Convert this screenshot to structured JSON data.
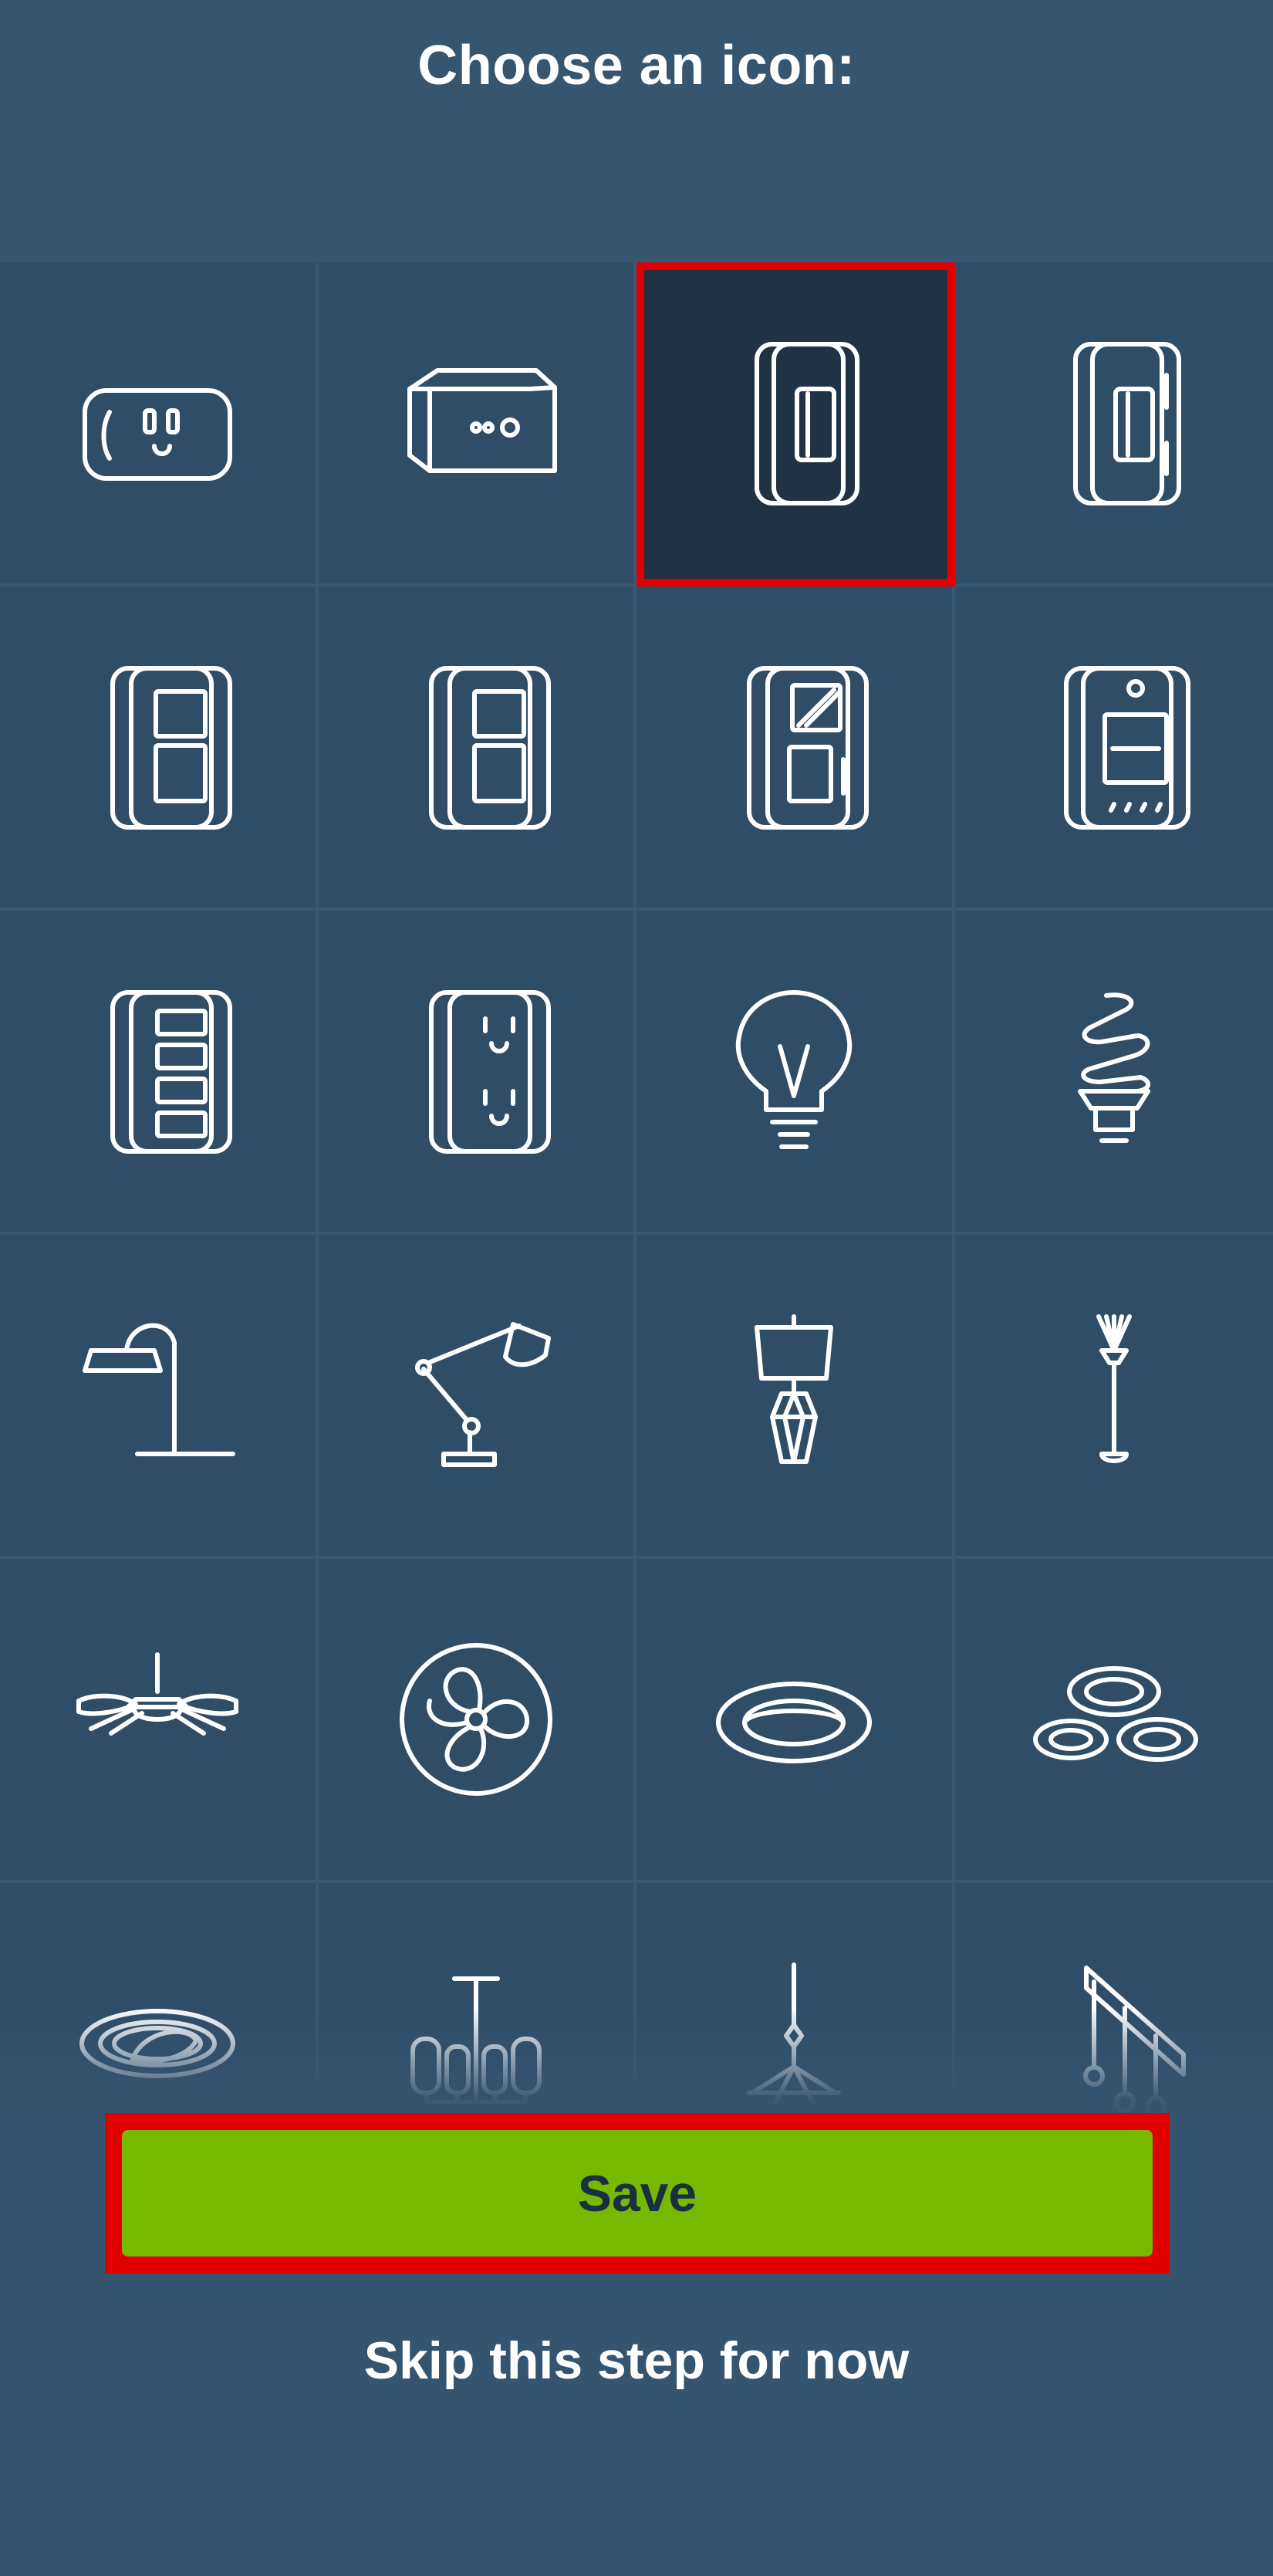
{
  "header": {
    "title": "Choose an icon:"
  },
  "icons": [
    {
      "name": "outlet-box-icon"
    },
    {
      "name": "plug-in-module-icon"
    },
    {
      "name": "toggle-switch-icon",
      "selected": true
    },
    {
      "name": "switch-with-side-button-icon"
    },
    {
      "name": "double-switch-icon"
    },
    {
      "name": "double-switch-with-indicator-icon"
    },
    {
      "name": "dimmer-switch-icon"
    },
    {
      "name": "smart-dimmer-icon"
    },
    {
      "name": "multi-button-switch-icon"
    },
    {
      "name": "wall-outlet-icon"
    },
    {
      "name": "light-bulb-icon"
    },
    {
      "name": "cfl-bulb-icon"
    },
    {
      "name": "desk-lamp-icon"
    },
    {
      "name": "architect-lamp-icon"
    },
    {
      "name": "table-lamp-icon"
    },
    {
      "name": "floor-lamp-icon"
    },
    {
      "name": "ceiling-fan-icon"
    },
    {
      "name": "fan-icon"
    },
    {
      "name": "recessed-light-icon"
    },
    {
      "name": "recessed-lights-group-icon"
    },
    {
      "name": "eyeball-recessed-light-icon"
    },
    {
      "name": "chandelier-icon"
    },
    {
      "name": "pendant-chandelier-icon"
    },
    {
      "name": "track-lighting-icon"
    }
  ],
  "actions": {
    "save_label": "Save",
    "skip_label": "Skip this step for now"
  }
}
